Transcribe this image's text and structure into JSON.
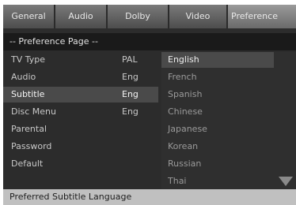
{
  "tabs": [
    {
      "label": "General"
    },
    {
      "label": "Audio"
    },
    {
      "label": "Dolby"
    },
    {
      "label": "Video"
    },
    {
      "label": "Preference"
    }
  ],
  "active_tab": "Preference",
  "page_title": "-- Preference Page --",
  "settings": [
    {
      "label": "TV Type",
      "value": "PAL"
    },
    {
      "label": "Audio",
      "value": "Eng"
    },
    {
      "label": "Subtitle",
      "value": "Eng"
    },
    {
      "label": "Disc Menu",
      "value": "Eng"
    },
    {
      "label": "Parental",
      "value": ""
    },
    {
      "label": "Password",
      "value": ""
    },
    {
      "label": "Default",
      "value": ""
    }
  ],
  "selected_setting": "Subtitle",
  "languages": [
    "English",
    "French",
    "Spanish",
    "Chinese",
    "Japanese",
    "Korean",
    "Russian",
    "Thai"
  ],
  "highlighted_language": "English",
  "scroll_icon": "triangle-down-icon",
  "status_text": "Preferred Subtitle Language",
  "colors": {
    "background": "#2c2c2c",
    "tab": "#6a6a6a",
    "selection": "#4a4a4a",
    "status_bar": "#c0c0c0"
  }
}
